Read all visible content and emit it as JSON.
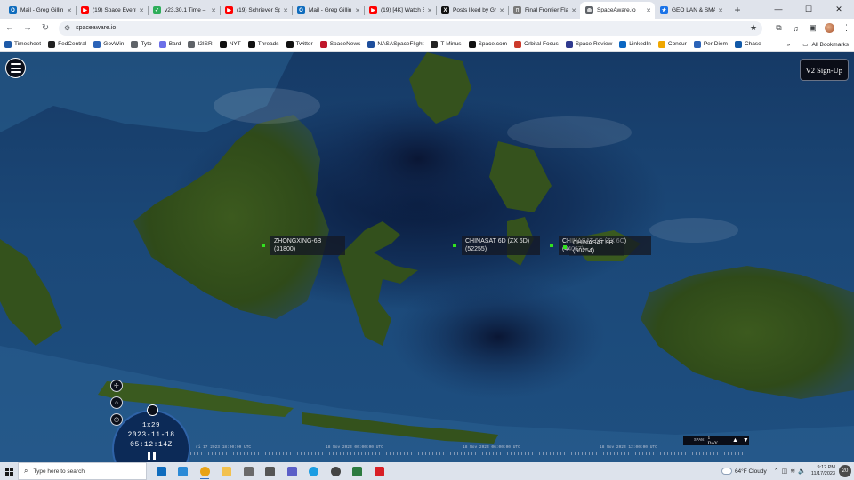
{
  "browser": {
    "tabs": [
      {
        "label": "Mail - Greg Gillin",
        "icon": "outlook-icon",
        "color": "#0f6cbd",
        "glyph": "O"
      },
      {
        "label": "(19) Space Eventi",
        "icon": "youtube-icon",
        "color": "#ff0000",
        "glyph": "▶"
      },
      {
        "label": "v23.30.1 Time –",
        "icon": "check-icon",
        "color": "#2eae5a",
        "glyph": "✓"
      },
      {
        "label": "(19) Schriever Spa",
        "icon": "youtube-icon",
        "color": "#ff0000",
        "glyph": "▶"
      },
      {
        "label": "Mail - Greg Gillin",
        "icon": "outlook-icon",
        "color": "#0f6cbd",
        "glyph": "O"
      },
      {
        "label": "(19) [4K] Watch S",
        "icon": "youtube-icon",
        "color": "#ff0000",
        "glyph": "▶"
      },
      {
        "label": "Posts liked by Gr",
        "icon": "x-icon",
        "color": "#111111",
        "glyph": "X"
      },
      {
        "label": "Final Frontier Fla",
        "icon": "page-icon",
        "color": "#7a7a7a",
        "glyph": "▯"
      },
      {
        "label": "SpaceAware.io",
        "icon": "globe-icon",
        "color": "#5f6368",
        "glyph": "◍"
      },
      {
        "label": "GEO LAN & SMA",
        "icon": "star-icon",
        "color": "#1a73e8",
        "glyph": "★"
      }
    ],
    "url": "spaceaware.io",
    "bookmarks": [
      {
        "label": "Timesheet",
        "icon": "timesheet-icon",
        "color": "#1e5aa8"
      },
      {
        "label": "FedCentral",
        "icon": "fedcentral-icon",
        "color": "#222222"
      },
      {
        "label": "GovWin",
        "icon": "govwin-icon",
        "color": "#2b63b8"
      },
      {
        "label": "Tyto",
        "icon": "folder-icon",
        "color": "#5f6368"
      },
      {
        "label": "Bard",
        "icon": "bard-icon",
        "color": "#6b6fe8"
      },
      {
        "label": "I2ISR",
        "icon": "folder-icon",
        "color": "#5f6368"
      },
      {
        "label": "NYT",
        "icon": "nyt-icon",
        "color": "#111111"
      },
      {
        "label": "Threads",
        "icon": "threads-icon",
        "color": "#111111"
      },
      {
        "label": "Twitter",
        "icon": "x-icon",
        "color": "#111111"
      },
      {
        "label": "SpaceNews",
        "icon": "spacenews-icon",
        "color": "#c0172b"
      },
      {
        "label": "NASASpaceFlight",
        "icon": "nsf-icon",
        "color": "#1e4e9c"
      },
      {
        "label": "T-Minus",
        "icon": "tminus-icon",
        "color": "#222222"
      },
      {
        "label": "Space.com",
        "icon": "spacecom-icon",
        "color": "#111111"
      },
      {
        "label": "Orbital Focus",
        "icon": "orbital-icon",
        "color": "#cc3a2b"
      },
      {
        "label": "Space Review",
        "icon": "spacereview-icon",
        "color": "#2f3a8f"
      },
      {
        "label": "LinkedIn",
        "icon": "linkedin-icon",
        "color": "#0a66c2"
      },
      {
        "label": "Concur",
        "icon": "concur-icon",
        "color": "#f0a700"
      },
      {
        "label": "Per Diem",
        "icon": "perdiem-icon",
        "color": "#2b63b8"
      },
      {
        "label": "Chase",
        "icon": "chase-icon",
        "color": "#1159a8"
      }
    ],
    "all_bookmarks": "All Bookmarks"
  },
  "app": {
    "signup_label": "V2 Sign-Up",
    "satellites": [
      {
        "name": "ZHONGXING-6B",
        "id": "(31800)"
      },
      {
        "name": "CHINASAT 6D (ZX 6D)",
        "id": "(52255)"
      },
      {
        "name": "CHINASAT 6C (ZX 6C)",
        "id": "(44067)"
      },
      {
        "name": "CHINASAT 9B",
        "id": "(50254)"
      }
    ],
    "clock": {
      "speed": "1x29",
      "date": "2023-11-18",
      "time": "05:12:14Z"
    },
    "timeline_labels": [
      "ri 17 2023 18:00:00 UTC",
      "18 Nov 2023 00:00:00 UTC",
      "18 Nov 2023 06:00:00 UTC",
      "18 Nov 2023 12:00:00 UTC"
    ],
    "zoom": {
      "unit_label": "SPAN:",
      "value": "1 DAY"
    }
  },
  "taskbar": {
    "search_placeholder": "Type here to search",
    "apps": [
      {
        "name": "outlook-app",
        "color": "#0f6cbd"
      },
      {
        "name": "snip-app",
        "color": "#2b8ad6"
      },
      {
        "name": "chrome-app",
        "color": "#e8a317"
      },
      {
        "name": "file-explorer-app",
        "color": "#f2c14e"
      },
      {
        "name": "settings-app",
        "color": "#6a6a6a"
      },
      {
        "name": "calculator-app",
        "color": "#555555"
      },
      {
        "name": "teams-app",
        "color": "#5b5fc7"
      },
      {
        "name": "edge-app",
        "color": "#1b9de2"
      },
      {
        "name": "chat-app",
        "color": "#444444"
      },
      {
        "name": "notes-app",
        "color": "#2c7a3f"
      },
      {
        "name": "acrobat-app",
        "color": "#d81f26"
      }
    ],
    "weather": "64°F  Cloudy",
    "time": "9:12 PM",
    "date": "11/17/2023",
    "notifications": "20"
  }
}
